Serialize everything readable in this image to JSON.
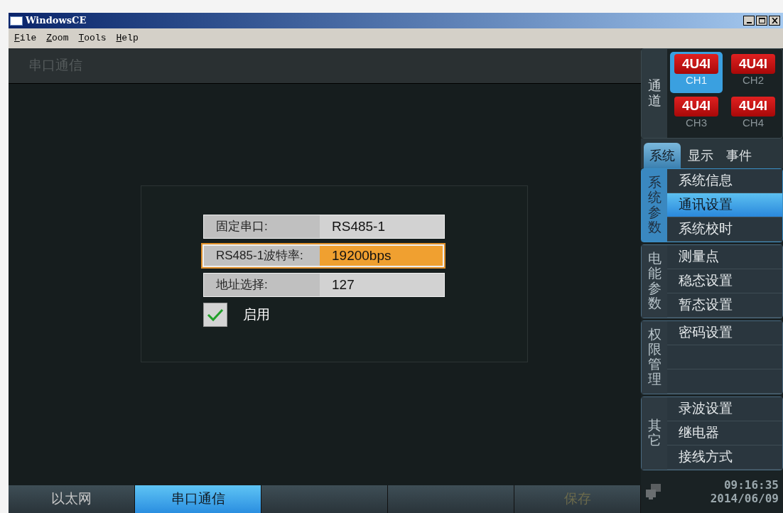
{
  "window": {
    "title": "WindowsCE"
  },
  "menu": [
    "File",
    "Zoom",
    "Tools",
    "Help"
  ],
  "page_title": "串口通信",
  "fields": [
    {
      "label": "固定串口:",
      "value": "RS485-1",
      "selected": false
    },
    {
      "label": "RS485-1波特率:",
      "value": "19200bps",
      "selected": true
    },
    {
      "label": "地址选择:",
      "value": "127",
      "selected": false
    }
  ],
  "enable": {
    "label": "启用",
    "checked": true
  },
  "bottom_tabs": [
    {
      "label": "以太网",
      "selected": false
    },
    {
      "label": "串口通信",
      "selected": true
    },
    {
      "selected": false
    },
    {
      "selected": false
    },
    {
      "label": "保存",
      "selected": false,
      "disabled": true
    }
  ],
  "channel_label": "通道",
  "channels": [
    {
      "badge": "4U4I",
      "name": "CH1",
      "selected": true
    },
    {
      "badge": "4U4I",
      "name": "CH2",
      "selected": false
    },
    {
      "badge": "4U4I",
      "name": "CH3",
      "selected": false
    },
    {
      "badge": "4U4I",
      "name": "CH4",
      "selected": false
    }
  ],
  "tabs": [
    {
      "label": "系统",
      "selected": true
    },
    {
      "label": "显示",
      "selected": false
    },
    {
      "label": "事件",
      "selected": false
    }
  ],
  "groups": [
    {
      "label": "系统参数",
      "selected": true,
      "items": [
        {
          "label": "系统信息",
          "selected": false
        },
        {
          "label": "通讯设置",
          "selected": true
        },
        {
          "label": "系统校时",
          "selected": false
        }
      ]
    },
    {
      "label": "电能参数",
      "selected": false,
      "items": [
        {
          "label": "测量点",
          "selected": false
        },
        {
          "label": "稳态设置",
          "selected": false
        },
        {
          "label": "暂态设置",
          "selected": false
        }
      ]
    },
    {
      "label": "权限管理",
      "selected": false,
      "items": [
        {
          "label": "密码设置",
          "selected": false
        },
        {
          "selected": false
        },
        {
          "selected": false
        }
      ]
    },
    {
      "label": "其它",
      "selected": false,
      "items": [
        {
          "label": "录波设置",
          "selected": false
        },
        {
          "label": "继电器",
          "selected": false
        },
        {
          "label": "接线方式",
          "selected": false
        }
      ]
    }
  ],
  "status": {
    "time": "09:16:35",
    "date": "2014/06/09"
  }
}
